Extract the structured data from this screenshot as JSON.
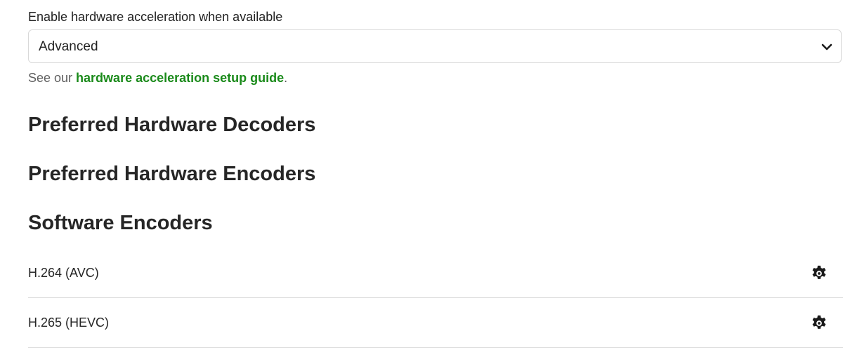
{
  "hardware_acceleration": {
    "label": "Enable hardware acceleration when available",
    "selected_value": "Advanced",
    "helper_prefix": "See our ",
    "helper_link": "hardware acceleration setup guide",
    "helper_suffix": "."
  },
  "sections": {
    "decoders_title": "Preferred Hardware Decoders",
    "encoders_title": "Preferred Hardware Encoders",
    "software_title": "Software Encoders"
  },
  "software_encoders": [
    {
      "label": "H.264 (AVC)",
      "icon": "gear-icon"
    },
    {
      "label": "H.265 (HEVC)",
      "icon": "gear-icon"
    }
  ],
  "colors": {
    "link": "#1a8a1a",
    "divider": "#dedede"
  }
}
